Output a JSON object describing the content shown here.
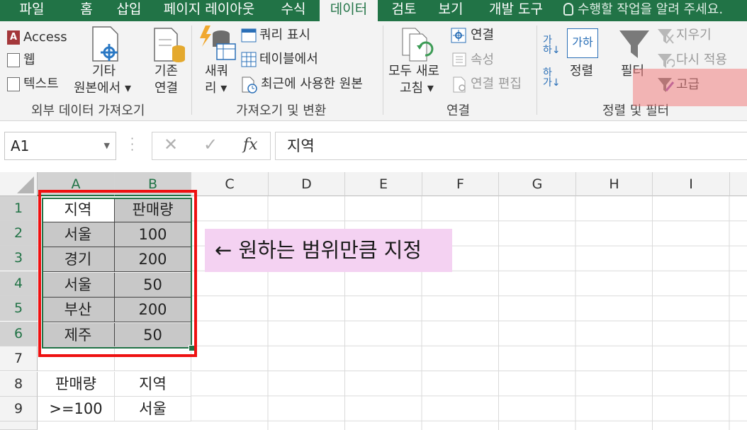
{
  "tabs": [
    "파일",
    "홈",
    "삽입",
    "페이지 레이아웃",
    "수식",
    "데이터",
    "검토",
    "보기",
    "개발 도구"
  ],
  "tell_me": "수행할 작업을 알려 주세요.",
  "ribbon": {
    "external": {
      "access": "Access",
      "web": "웹",
      "text": "텍스트",
      "other_l1": "기타",
      "other_l2": "원본에서",
      "existing_l1": "기존",
      "existing_l2": "연결",
      "group": "외부 데이터 가져오기"
    },
    "transform": {
      "new_l1": "새쿼",
      "new_l2": "리",
      "show_query": "쿼리 표시",
      "from_table": "테이블에서",
      "recent_source": "최근에 사용한 원본",
      "group": "가져오기 및 변환"
    },
    "connections": {
      "refresh_l1": "모두 새로",
      "refresh_l2": "고침",
      "connections": "연결",
      "properties": "속성",
      "edit_links": "연결 편집",
      "group": "연결"
    },
    "sortfilter": {
      "sort": "정렬",
      "filter": "필터",
      "clear": "지우기",
      "reapply": "다시 적용",
      "advanced": "고급",
      "group": "정렬 및 필터"
    }
  },
  "name_box": "A1",
  "formula_value": "지역",
  "columns": [
    "A",
    "B",
    "C",
    "D",
    "E",
    "F",
    "G",
    "H",
    "I"
  ],
  "rows": [
    "1",
    "2",
    "3",
    "4",
    "5",
    "6",
    "7",
    "8",
    "9"
  ],
  "cells": {
    "A1": "지역",
    "B1": "판매량",
    "A2": "서울",
    "B2": "100",
    "A3": "경기",
    "B3": "200",
    "A4": "서울",
    "B4": "50",
    "A5": "부산",
    "B5": "200",
    "A6": "제주",
    "B6": "50",
    "A8": "판매량",
    "B8": "지역",
    "A9": ">=100",
    "B9": "서울"
  },
  "annotation": "← 원하는 범위만큼 지정",
  "colors": {
    "excel_green": "#217346",
    "highlight_red": "#ee1111",
    "note_bg": "#f4d2f2"
  }
}
